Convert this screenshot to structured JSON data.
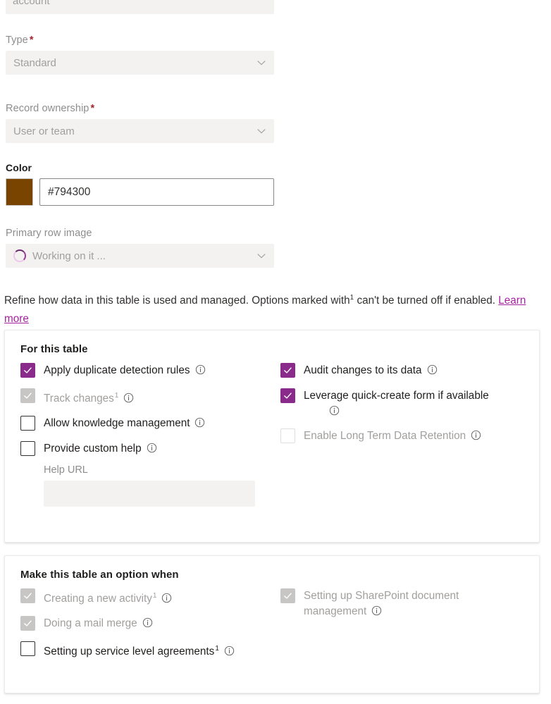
{
  "clipped_field": {
    "value": "account"
  },
  "fields": [
    {
      "label": "Type",
      "required": true,
      "value": "Standard",
      "icon": "chevron-down-icon"
    },
    {
      "label": "Record ownership",
      "required": true,
      "value": "User or team",
      "icon": "chevron-down-icon"
    }
  ],
  "color": {
    "label": "Color",
    "swatch_hex": "#794300",
    "value": "#794300"
  },
  "primary_row_image": {
    "label": "Primary row image",
    "value": "Working on it ...",
    "icon": "spinner-icon",
    "chevron": "chevron-down-icon"
  },
  "description": {
    "text_before": "Refine how data in this table is used and managed. Options marked with",
    "marker": "1",
    "text_after": "can't be turned off if enabled.",
    "link_label": "Learn more",
    "link_color": "#a4239f"
  },
  "cards": [
    {
      "title": "For this table",
      "left_column": [
        {
          "label": "Apply duplicate detection rules",
          "state": "checked",
          "marker": "",
          "info": "info-icon"
        },
        {
          "label": "Track changes",
          "state": "disabled-checked",
          "marker": "1",
          "info": "info-icon"
        },
        {
          "label": "Allow knowledge management",
          "state": "unchecked",
          "marker": "",
          "info": "info-icon"
        },
        {
          "label": "Provide custom help",
          "state": "unchecked",
          "marker": "",
          "info": "info-icon"
        }
      ],
      "right_column": [
        {
          "label": "Audit changes to its data",
          "state": "checked",
          "marker": "",
          "info": "info-icon"
        },
        {
          "label": "Leverage quick-create form if available",
          "state": "checked",
          "marker": "",
          "info": "info-icon",
          "info_on_new_line": true
        },
        {
          "label": "Enable Long Term Data Retention",
          "state": "disabled-unchecked",
          "marker": "",
          "info": "info-icon"
        }
      ],
      "help_url": {
        "label": "Help URL",
        "value": ""
      }
    },
    {
      "title": "Make this table an option when",
      "left_column": [
        {
          "label": "Creating a new activity",
          "state": "disabled-checked",
          "marker": "1",
          "info": "info-icon"
        },
        {
          "label": "Doing a mail merge",
          "state": "disabled-checked",
          "marker": "",
          "info": "info-icon"
        },
        {
          "label": "Setting up service level agreements",
          "state": "unchecked",
          "marker": "1",
          "info": "info-icon"
        }
      ],
      "right_column": [
        {
          "label": "Setting up SharePoint document management",
          "state": "disabled-checked",
          "marker": "",
          "info": "info-icon"
        }
      ]
    }
  ],
  "colors": {
    "accent_purple": "#8a2a8b",
    "link_purple": "#a4239f",
    "required_red": "#a4262c",
    "swatch_brown": "#794300"
  }
}
